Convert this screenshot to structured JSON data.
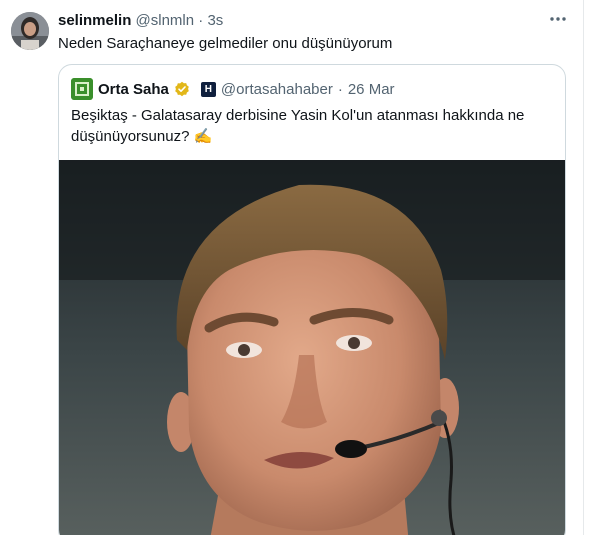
{
  "tweet": {
    "author_name": "selinmelin",
    "author_handle": "@slnmln",
    "separator": "·",
    "timestamp": "3s",
    "text": "Neden Saraçhaneye gelmediler onu düşünüyorum"
  },
  "quoted": {
    "author_name": "Orta Saha",
    "author_handle": "@ortasahahaber",
    "separator": "·",
    "date": "26 Mar",
    "affiliate_badge": "H",
    "text": "Beşiktaş - Galatasaray derbisine Yasin Kol'un atanması hakkında ne düşünüyorsunuz? ✍️"
  },
  "icons": {
    "more": "more-horizontal-icon",
    "verified": "verified-badge-icon"
  },
  "colors": {
    "text_primary": "#0f1419",
    "text_secondary": "#536471",
    "border": "#cfd9de",
    "verified_gold": "#e2b719",
    "logo_green": "#3a8f2b"
  }
}
